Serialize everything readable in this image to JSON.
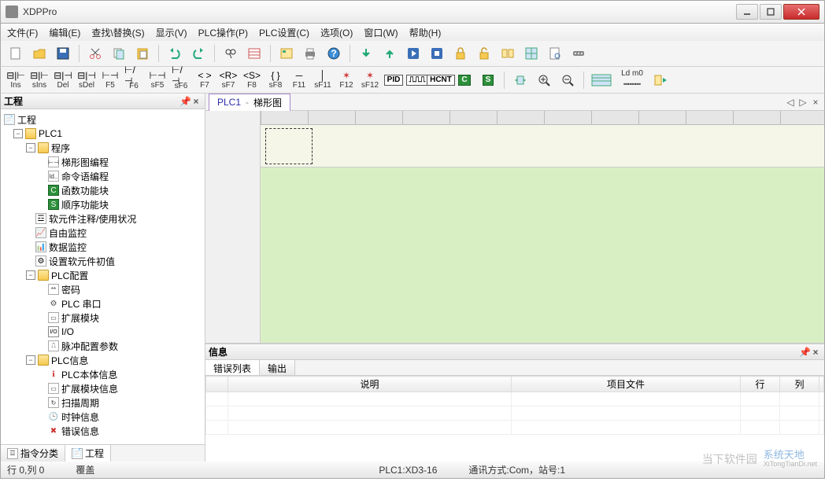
{
  "app": {
    "title": "XDPPro"
  },
  "menu": [
    "文件(F)",
    "编辑(E)",
    "查找\\替换(S)",
    "显示(V)",
    "PLC操作(P)",
    "PLC设置(C)",
    "选项(O)",
    "窗口(W)",
    "帮助(H)"
  ],
  "toolbar1": {
    "items": [
      "new",
      "open",
      "save",
      "cut",
      "copy",
      "paste",
      "undo",
      "redo",
      "find",
      "form",
      "table1",
      "print",
      "help",
      "down",
      "up",
      "play",
      "stop",
      "lock",
      "unlock",
      "compare",
      "grid",
      "preview",
      "serial"
    ]
  },
  "toolbar2": {
    "items": [
      {
        "icon": "ins",
        "label": "Ins"
      },
      {
        "icon": "sins",
        "label": "sIns"
      },
      {
        "icon": "del",
        "label": "Del"
      },
      {
        "icon": "sdel",
        "label": "sDel"
      },
      {
        "icon": "f5",
        "label": "F5"
      },
      {
        "icon": "f6",
        "label": "F6"
      },
      {
        "icon": "sf5",
        "label": "sF5"
      },
      {
        "icon": "sf6",
        "label": "sF6"
      },
      {
        "icon": "f7",
        "label": "F7"
      },
      {
        "icon": "sf7",
        "label": "sF7"
      },
      {
        "icon": "f8",
        "label": "F8"
      },
      {
        "icon": "sf8",
        "label": "sF8"
      },
      {
        "icon": "f11",
        "label": "F11"
      },
      {
        "icon": "sf11",
        "label": "sF11"
      },
      {
        "icon": "f12",
        "label": "F12"
      },
      {
        "icon": "sf12",
        "label": "sF12"
      },
      {
        "icon": "pid",
        "label": ""
      },
      {
        "icon": "pulse",
        "label": ""
      },
      {
        "icon": "hcnt",
        "label": ""
      },
      {
        "icon": "c",
        "label": ""
      },
      {
        "icon": "s",
        "label": ""
      },
      {
        "icon": "hfit",
        "label": ""
      },
      {
        "icon": "zoomin",
        "label": ""
      },
      {
        "icon": "zoomout",
        "label": ""
      },
      {
        "icon": "list",
        "label": ""
      },
      {
        "icon": "ldm0",
        "label": "Ld m0"
      },
      {
        "icon": "convert",
        "label": ""
      }
    ]
  },
  "project_pane": {
    "title": "工程",
    "root": "工程",
    "tree": {
      "plc1": "PLC1",
      "program": "程序",
      "ladder": "梯形图编程",
      "instruction": "命令语编程",
      "funcblock": "函数功能块",
      "seqblock": "顺序功能块",
      "comment": "软元件注释/使用状况",
      "freewatch": "自由监控",
      "datawatch": "数据监控",
      "setinit": "设置软元件初值",
      "plcconfig": "PLC配置",
      "password": "密码",
      "plcserial": "PLC 串口",
      "extmodule": "扩展模块",
      "io": "I/O",
      "pulseparam": "脉冲配置参数",
      "plcinfo": "PLC信息",
      "plcbody": "PLC本体信息",
      "extinfo": "扩展模块信息",
      "scancycle": "扫描周期",
      "clockinfo": "时钟信息",
      "errorinfo": "错误信息"
    },
    "tabs": {
      "instr_class": "指令分类",
      "project": "工程"
    }
  },
  "editor": {
    "tab_main": "PLC1",
    "tab_sub": "梯形图"
  },
  "info_pane": {
    "title": "信息",
    "tabs": {
      "errors": "错误列表",
      "output": "输出"
    },
    "columns": {
      "desc": "说明",
      "file": "项目文件",
      "row": "行",
      "col": "列"
    }
  },
  "status": {
    "pos": "行 0,列 0",
    "mode": "覆盖",
    "plc": "PLC1:XD3-16",
    "comm": "通讯方式:Com，站号:1"
  },
  "watermark": {
    "a": "当下软件园",
    "b": "系统天地",
    "c": "XiTongTianDi.net"
  }
}
